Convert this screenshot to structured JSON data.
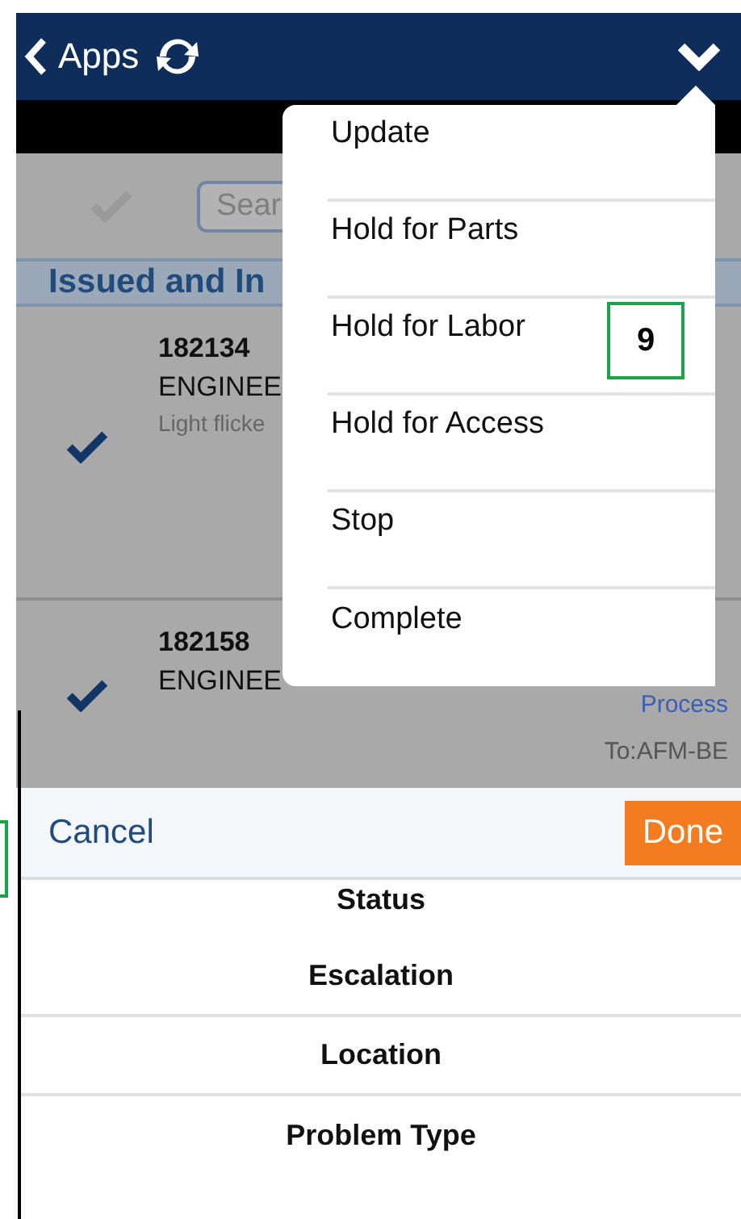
{
  "header": {
    "back_label": "Apps"
  },
  "select_all": {
    "checked": false
  },
  "search": {
    "placeholder": "Sear"
  },
  "section_title": "Issued and In",
  "work_orders": [
    {
      "number": "182134",
      "trade": "ENGINEE",
      "description": "Light flicke",
      "checked": true
    },
    {
      "number": "182158",
      "trade": "ENGINEE",
      "status": "Process",
      "assignee": "To:AFM-BE",
      "checked": true
    }
  ],
  "menu": {
    "items": [
      "Update",
      "Hold for Parts",
      "Hold for Labor",
      "Hold for Access",
      "Stop",
      "Complete"
    ]
  },
  "annotation": {
    "label": "9"
  },
  "picker": {
    "cancel": "Cancel",
    "done": "Done",
    "options": [
      "Status",
      "Escalation",
      "Location",
      "Problem Type"
    ]
  }
}
